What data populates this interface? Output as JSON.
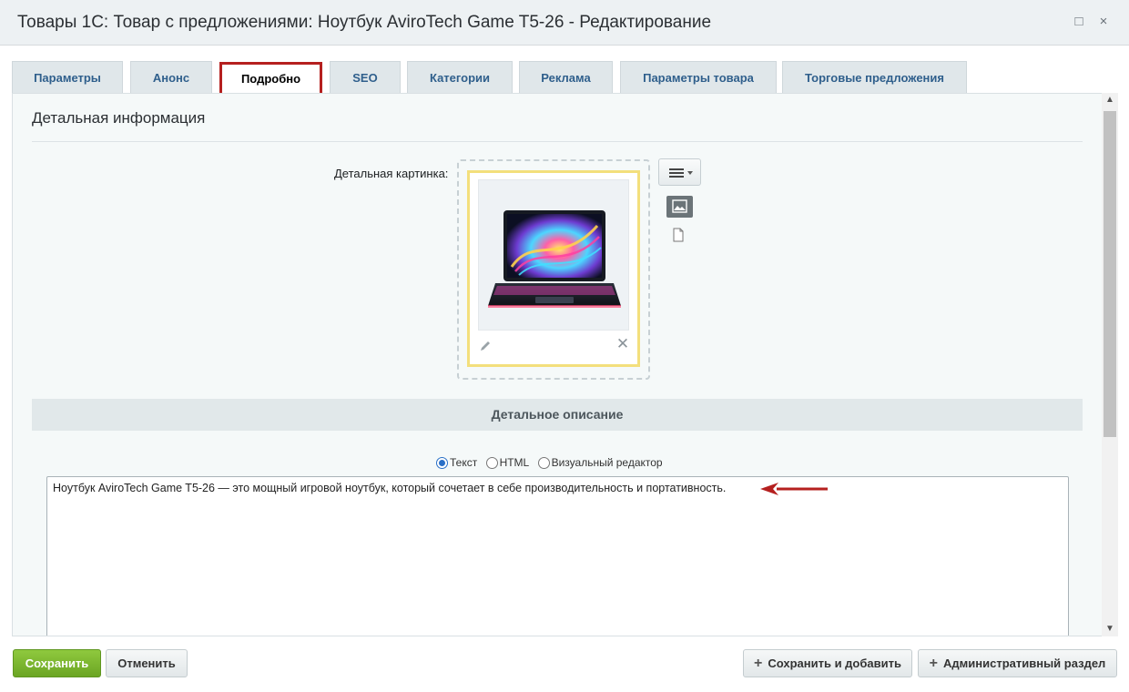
{
  "window": {
    "title": "Товары 1С: Товар с предложениями: Ноутбук AviroTech Game T5-26 - Редактирование",
    "maximize_glyph": "□",
    "close_glyph": "×"
  },
  "tabs": [
    {
      "label": "Параметры"
    },
    {
      "label": "Анонс"
    },
    {
      "label": "Подробно",
      "active": true
    },
    {
      "label": "SEO"
    },
    {
      "label": "Категории"
    },
    {
      "label": "Реклама"
    },
    {
      "label": "Параметры товара"
    },
    {
      "label": "Торговые предложения"
    }
  ],
  "section": {
    "title": "Детальная информация",
    "picture_label": "Детальная картинка:",
    "picture_icons": [
      "pencil-icon",
      "close-icon",
      "menu-icon",
      "image-icon",
      "file-icon"
    ],
    "description_band": "Детальное описание"
  },
  "editor": {
    "modes": [
      {
        "label": "Текст",
        "checked": true
      },
      {
        "label": "HTML",
        "checked": false
      },
      {
        "label": "Визуальный редактор",
        "checked": false
      }
    ],
    "text": "Ноутбук AviroTech Game T5-26 — это мощный игровой ноутбук, который сочетает в себе производительность и портативность."
  },
  "footer": {
    "save": "Сохранить",
    "cancel": "Отменить",
    "save_add": "Сохранить и добавить",
    "admin": "Административный раздел"
  },
  "colors": {
    "accent_red": "#b5201f",
    "save_green": "#7ab62e",
    "tab_text": "#2f5f8c"
  }
}
